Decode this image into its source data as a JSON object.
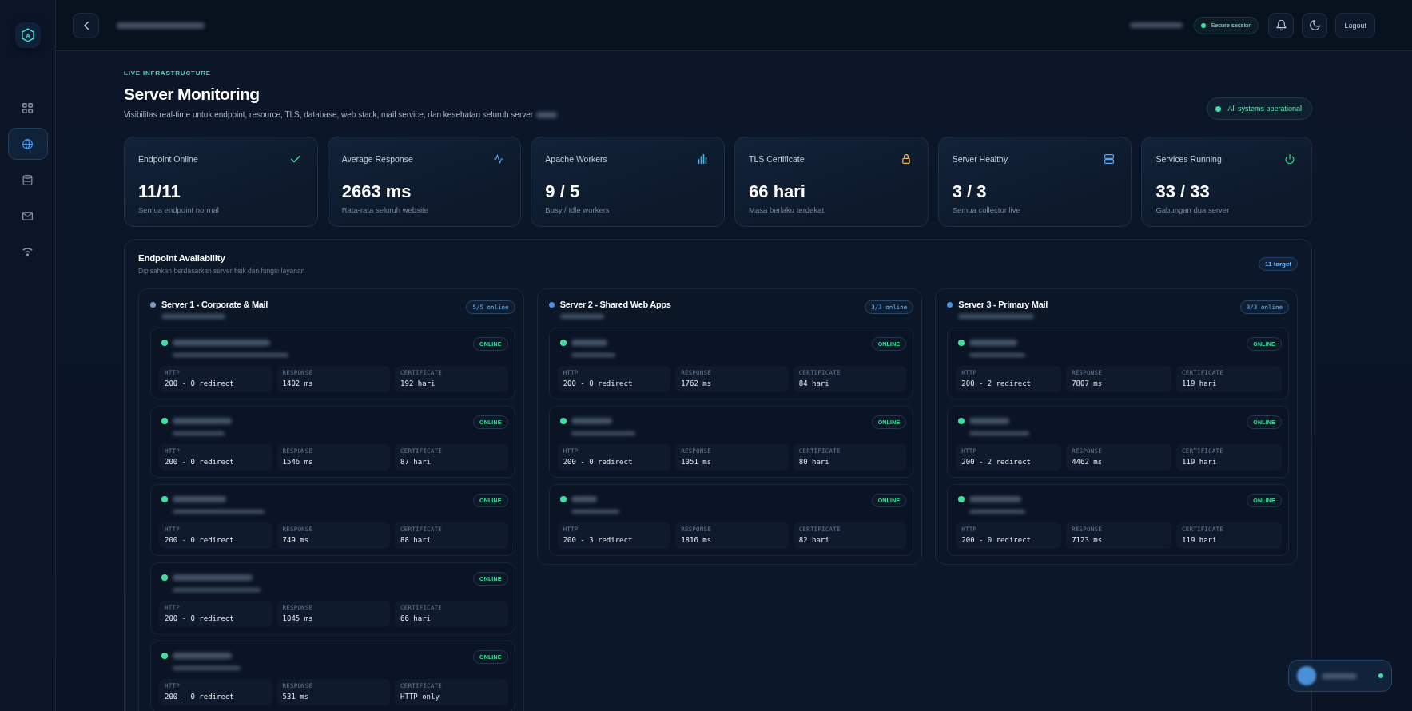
{
  "sidebar": {
    "logo": "A",
    "items": [
      {
        "kind": "overview",
        "selected": false
      },
      {
        "kind": "web",
        "selected": true
      },
      {
        "kind": "database",
        "selected": false
      },
      {
        "kind": "mail",
        "selected": false
      },
      {
        "kind": "network",
        "selected": false
      }
    ]
  },
  "topbar": {
    "session": {
      "label": "Secure session",
      "secure": true
    },
    "buttons": [
      {
        "kind": "notifications"
      },
      {
        "kind": "theme"
      },
      {
        "kind": "logout",
        "label": "Logout"
      }
    ]
  },
  "header": {
    "eyebrow": "LIVE INFRASTRUCTURE",
    "title": "Server Monitoring",
    "subtitle": "Visibilitas real-time untuk endpoint, resource, TLS, database, web stack, mail service, dan kesehatan seluruh server",
    "status": {
      "label": "All systems operational",
      "ok": true
    }
  },
  "stats": [
    {
      "kind": "availability",
      "label": "Endpoint Online",
      "value": "11/11",
      "caption": "Semua endpoint normal"
    },
    {
      "kind": "latency",
      "label": "Average Response",
      "value": "2663 ms",
      "caption": "Rata-rata seluruh website"
    },
    {
      "kind": "workers",
      "label": "Apache Workers",
      "value": "9 / 5",
      "caption": "Busy / Idle workers"
    },
    {
      "kind": "certificate",
      "label": "TLS Certificate",
      "value": "66 hari",
      "caption": "Masa berlaku terdekat"
    },
    {
      "kind": "health",
      "label": "Server Healthy",
      "value": "3 / 3",
      "caption": "Semua collector live"
    },
    {
      "kind": "services",
      "label": "Services Running",
      "value": "33 / 33",
      "caption": "Gabungan dua server"
    }
  ],
  "availability": {
    "title": "Endpoint Availability",
    "subtitle": "Dipisahkan berdasarkan server fisik dan fungsi layanan",
    "badge": "11 target",
    "servers": [
      {
        "name": "Server 1 - Corporate & Mail",
        "color": "#7a9cc0",
        "badge": "5/5 online",
        "endpoints": [
          {
            "status": "ONLINE",
            "online": true,
            "metrics": [
              {
                "label": "HTTP",
                "value": "200 - 0 redirect"
              },
              {
                "label": "RESPONSE",
                "value": "1402 ms"
              },
              {
                "label": "CERTIFICATE",
                "value": "192 hari"
              }
            ]
          },
          {
            "status": "ONLINE",
            "online": true,
            "metrics": [
              {
                "label": "HTTP",
                "value": "200 - 0 redirect"
              },
              {
                "label": "RESPONSE",
                "value": "1546 ms"
              },
              {
                "label": "CERTIFICATE",
                "value": "87 hari"
              }
            ]
          },
          {
            "status": "ONLINE",
            "online": true,
            "metrics": [
              {
                "label": "HTTP",
                "value": "200 - 0 redirect"
              },
              {
                "label": "RESPONSE",
                "value": "749 ms"
              },
              {
                "label": "CERTIFICATE",
                "value": "88 hari"
              }
            ]
          },
          {
            "status": "ONLINE",
            "online": true,
            "metrics": [
              {
                "label": "HTTP",
                "value": "200 - 0 redirect"
              },
              {
                "label": "RESPONSE",
                "value": "1045 ms"
              },
              {
                "label": "CERTIFICATE",
                "value": "66 hari"
              }
            ]
          },
          {
            "status": "ONLINE",
            "online": true,
            "metrics": [
              {
                "label": "HTTP",
                "value": "200 - 0 redirect"
              },
              {
                "label": "RESPONSE",
                "value": "531 ms"
              },
              {
                "label": "CERTIFICATE",
                "value": "HTTP only"
              }
            ]
          }
        ]
      },
      {
        "name": "Server 2 - Shared Web Apps",
        "color": "#4b91e2",
        "badge": "3/3 online",
        "endpoints": [
          {
            "status": "ONLINE",
            "online": true,
            "metrics": [
              {
                "label": "HTTP",
                "value": "200 - 0 redirect"
              },
              {
                "label": "RESPONSE",
                "value": "1762 ms"
              },
              {
                "label": "CERTIFICATE",
                "value": "84 hari"
              }
            ]
          },
          {
            "status": "ONLINE",
            "online": true,
            "metrics": [
              {
                "label": "HTTP",
                "value": "200 - 0 redirect"
              },
              {
                "label": "RESPONSE",
                "value": "1051 ms"
              },
              {
                "label": "CERTIFICATE",
                "value": "80 hari"
              }
            ]
          },
          {
            "status": "ONLINE",
            "online": true,
            "metrics": [
              {
                "label": "HTTP",
                "value": "200 - 3 redirect"
              },
              {
                "label": "RESPONSE",
                "value": "1816 ms"
              },
              {
                "label": "CERTIFICATE",
                "value": "82 hari"
              }
            ]
          }
        ]
      },
      {
        "name": "Server 3 - Primary Mail",
        "color": "#4b91e2",
        "badge": "3/3 online",
        "endpoints": [
          {
            "status": "ONLINE",
            "online": true,
            "metrics": [
              {
                "label": "HTTP",
                "value": "200 - 2 redirect"
              },
              {
                "label": "RESPONSE",
                "value": "7807 ms"
              },
              {
                "label": "CERTIFICATE",
                "value": "119 hari"
              }
            ]
          },
          {
            "status": "ONLINE",
            "online": true,
            "metrics": [
              {
                "label": "HTTP",
                "value": "200 - 2 redirect"
              },
              {
                "label": "RESPONSE",
                "value": "4462 ms"
              },
              {
                "label": "CERTIFICATE",
                "value": "119 hari"
              }
            ]
          },
          {
            "status": "ONLINE",
            "online": true,
            "metrics": [
              {
                "label": "HTTP",
                "value": "200 - 0 redirect"
              },
              {
                "label": "RESPONSE",
                "value": "7123 ms"
              },
              {
                "label": "CERTIFICATE",
                "value": "119 hari"
              }
            ]
          }
        ]
      }
    ]
  },
  "user": {
    "online": true
  }
}
